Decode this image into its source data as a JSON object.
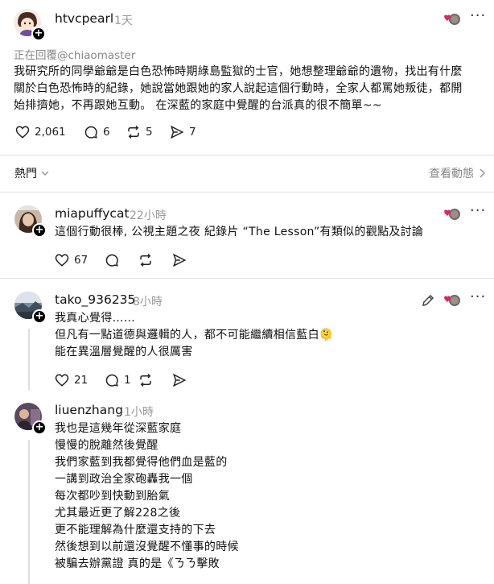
{
  "post": {
    "username": "htvcpearl",
    "time": "1天",
    "reply_to": "正在回覆@chiaomaster",
    "text_lines": [
      "我研究所的同學爺爺是白色恐怖時期綠島監獄的士官，她想整理爺爺的遺物，找出有什麼",
      "關於白色恐怖時的紀錄，她說當她跟她的家人說起這個行動時，全家人都罵她叛徒，都開",
      "始排擠她，不再跟她互動。 在深藍的家庭中覺醒的台派真的很不簡單~~"
    ],
    "likes": "2,061",
    "comments": "6",
    "reposts": "5",
    "shares": "7"
  },
  "sort": {
    "label": "熱門",
    "view_activity": "查看動態"
  },
  "replies": [
    {
      "username": "miapuffycat",
      "time": "22小時",
      "text_lines": [
        "這個行動很棒, 公視主題之夜 紀錄片 “The Lesson”有類似的觀點及討論"
      ],
      "likes": "67"
    },
    {
      "username": "tako_936235",
      "time": "8小時",
      "text_lines": [
        "我真心覺得……",
        "但凡有一點道德與邏輯的人，都不可能繼續相信藍白🫠",
        "能在異溫層覺醒的人很厲害"
      ],
      "likes": "21",
      "comments": "1"
    },
    {
      "username": "liuenzhang",
      "time": "1小時",
      "text_lines": [
        "我也是這幾年從深藍家庭",
        "慢慢的脫離然後覺醒",
        "我們家藍到我都覺得他們血是藍的",
        "一講到政治全家砲轟我一個",
        "每次都吵到快動到胎氣",
        "尤其最近更了解228之後",
        "更不能理解為什麼還支持的下去",
        "然後想到以前還沒覺醒不懂事的時候",
        "被騙去辦黨證 真的是《ㄋㄋ擊敗"
      ]
    }
  ],
  "colors": {
    "heart_red": "#e0245e",
    "muted": "#999999",
    "divider": "#e2e2e2"
  },
  "icons": [
    "heart-icon",
    "comment-icon",
    "repost-icon",
    "share-icon",
    "more-icon",
    "edit-icon",
    "chevron-right-icon",
    "chevron-down-icon"
  ]
}
